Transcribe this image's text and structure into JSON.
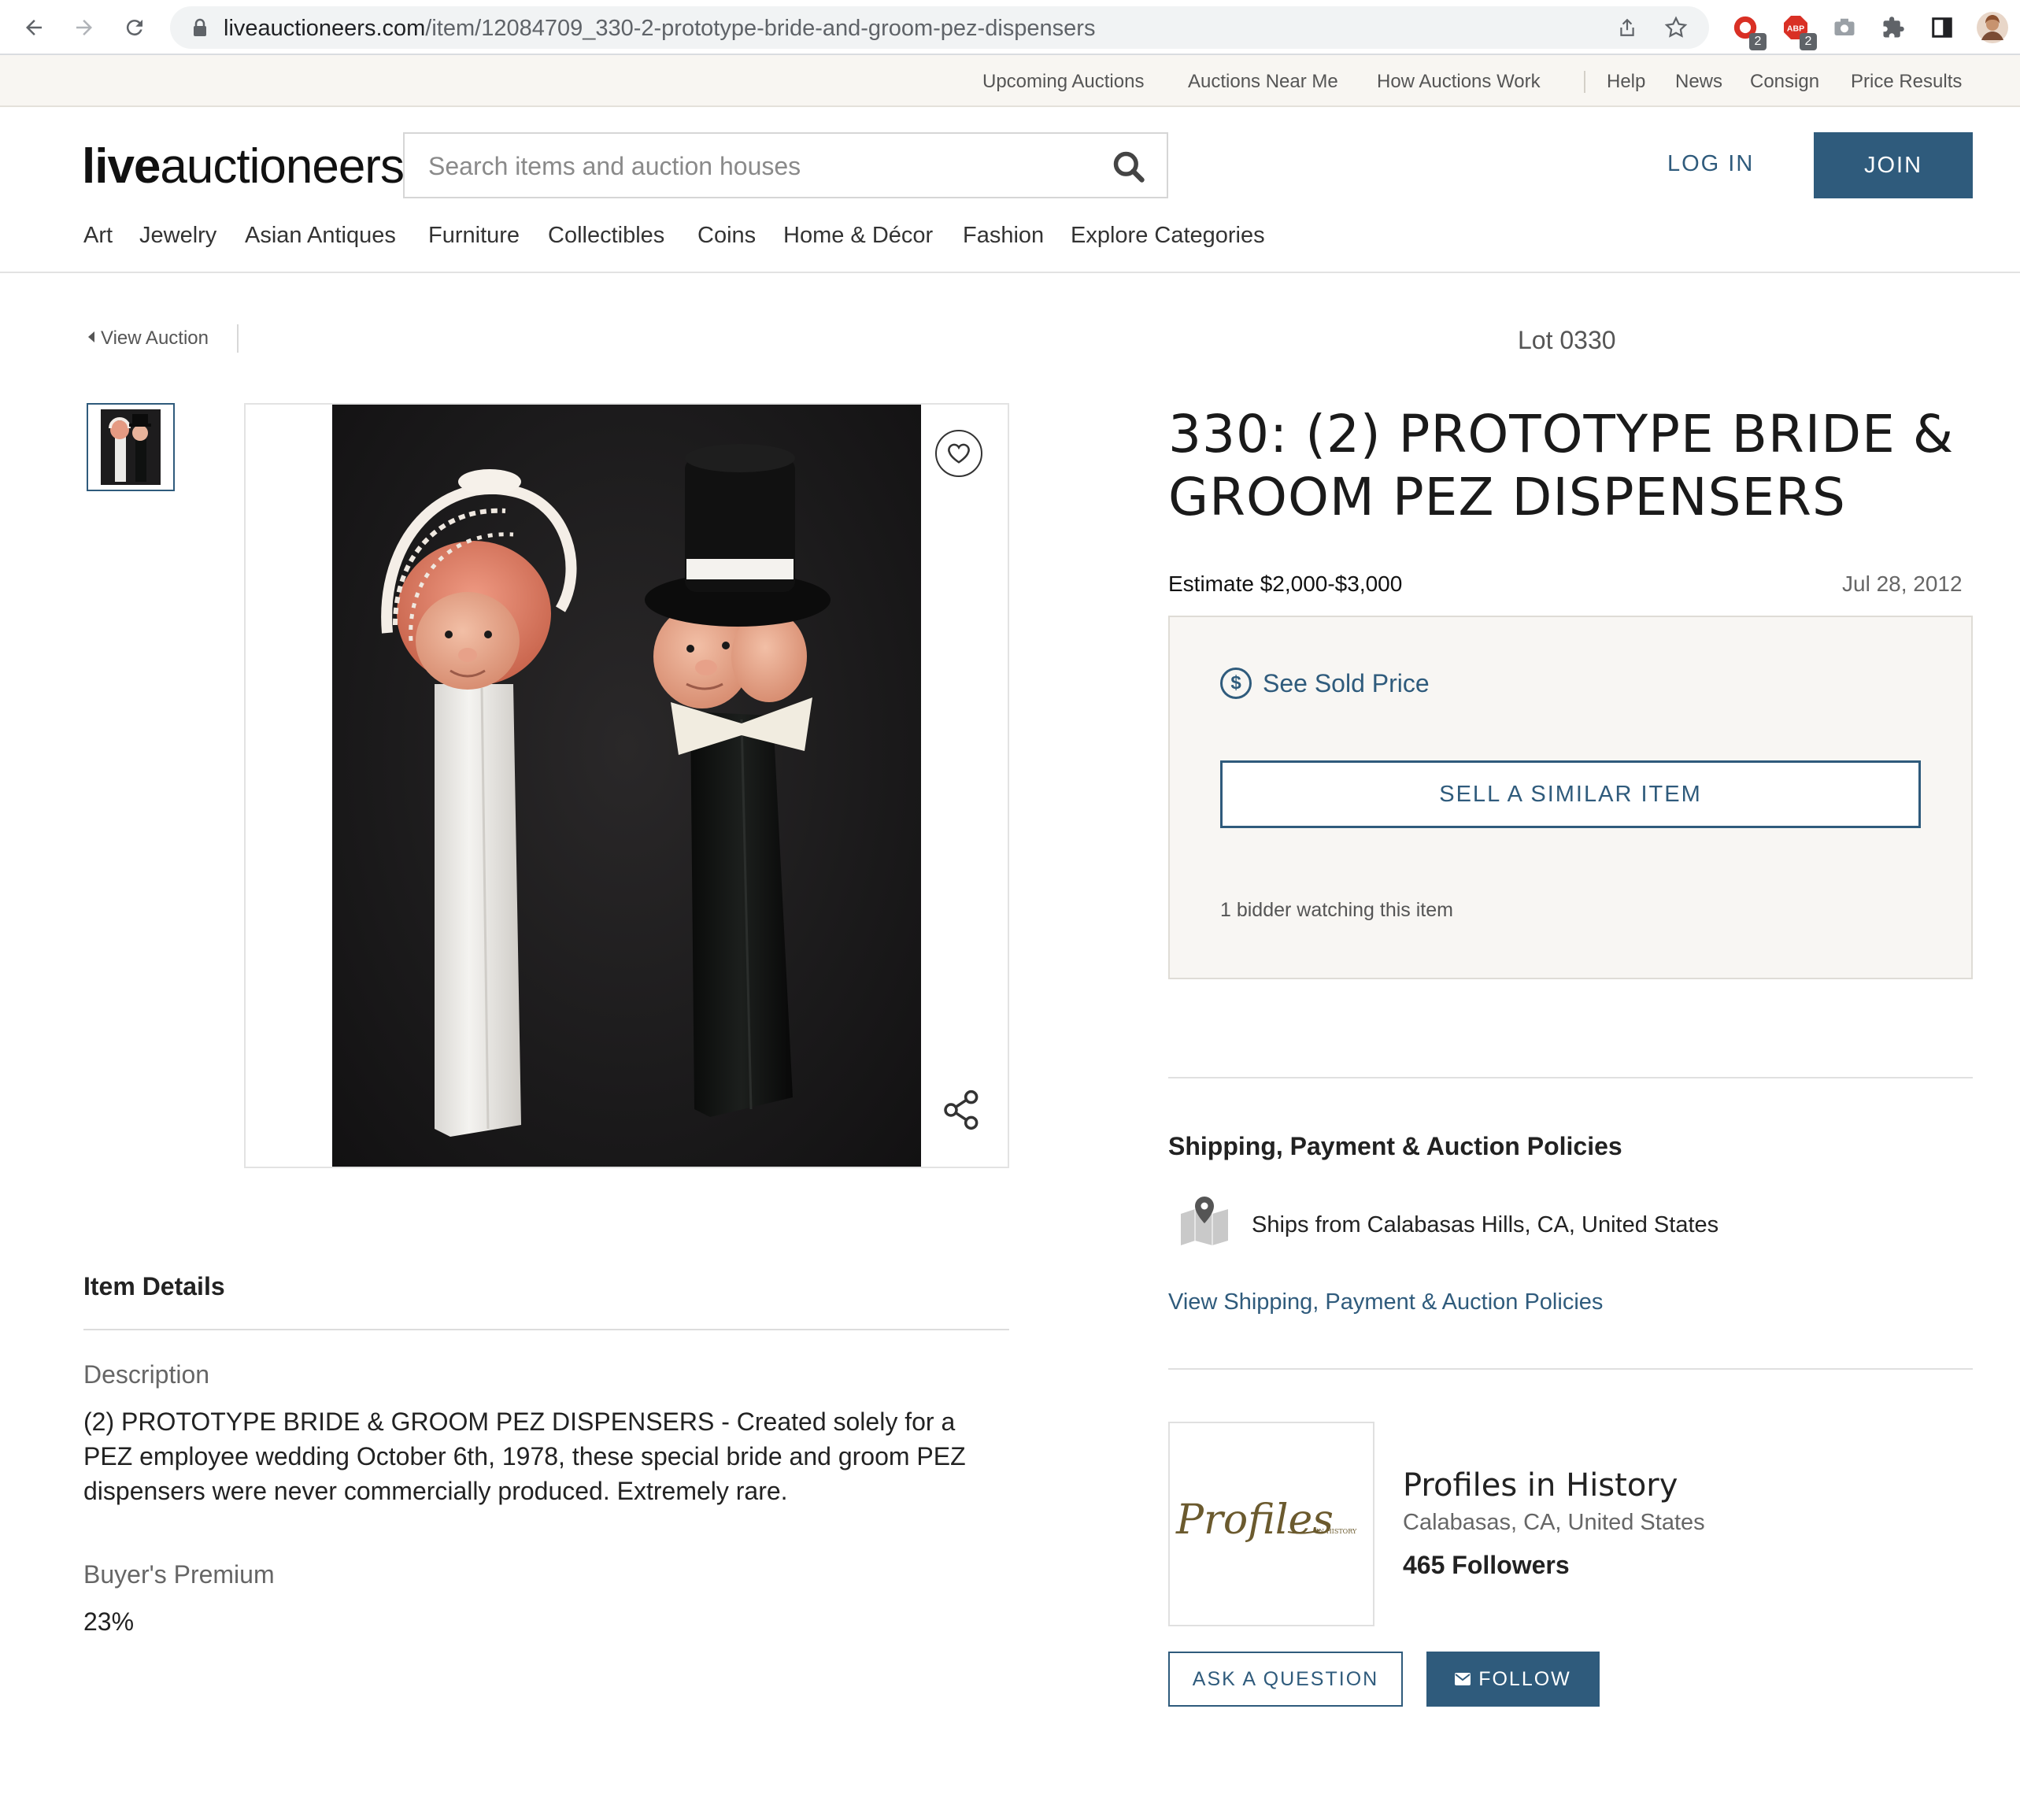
{
  "browser": {
    "url_host": "liveauctioneers.com",
    "url_path": "/item/12084709_330-2-prototype-bride-and-groom-pez-dispensers",
    "ext_badge_1": "2",
    "ext_badge_2": "2",
    "ext_abp_label": "ABP"
  },
  "util_nav": {
    "items": [
      "Upcoming Auctions",
      "Auctions Near Me",
      "How Auctions Work",
      "Help",
      "News",
      "Consign",
      "Price Results"
    ]
  },
  "header": {
    "logo_bold": "live",
    "logo_light": "auctioneers",
    "search_placeholder": "Search items and auction houses",
    "login_label": "LOG IN",
    "join_label": "JOIN"
  },
  "category_nav": {
    "items": [
      "Art",
      "Jewelry",
      "Asian Antiques",
      "Furniture",
      "Collectibles",
      "Coins",
      "Home & Décor",
      "Fashion",
      "Explore Categories"
    ]
  },
  "lot": {
    "view_auction": "View Auction",
    "lot_label": "Lot 0330",
    "title": "330: (2) PROTOTYPE BRIDE & GROOM PEZ DISPENSERS",
    "estimate": "Estimate $2,000-$3,000",
    "date": "Jul 28, 2012",
    "see_sold_price": "See Sold Price",
    "sell_similar": "SELL A SIMILAR ITEM",
    "watching": "1 bidder watching this item"
  },
  "details": {
    "heading": "Item Details",
    "description_label": "Description",
    "description_text": "(2) PROTOTYPE BRIDE & GROOM PEZ DISPENSERS - Created solely for a PEZ employee wedding October 6th, 1978, these special bride and groom PEZ dispensers were never commercially produced. Extremely rare.",
    "premium_label": "Buyer's Premium",
    "premium_value": "23%"
  },
  "shipping": {
    "heading": "Shipping, Payment & Auction Policies",
    "ships_from": "Ships from Calabasas Hills, CA, United States",
    "view_policies": "View Shipping, Payment & Auction Policies"
  },
  "house": {
    "logo_script": "Profiles",
    "logo_small": "IN HISTORY",
    "name": "Profiles in History",
    "location": "Calabasas, CA, United States",
    "followers": "465 Followers",
    "ask_label": "ASK A QUESTION",
    "follow_label": "FOLLOW"
  },
  "colors": {
    "brand_blue": "#2f5b7c",
    "util_bg": "#f8f6f2",
    "soldbox_bg": "#f8f6f3"
  }
}
